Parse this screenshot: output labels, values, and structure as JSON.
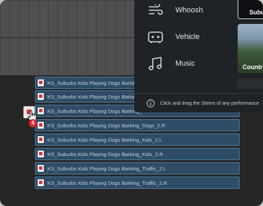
{
  "popup": {
    "items": [
      {
        "label": "Whoosh",
        "icon": "whoosh-icon"
      },
      {
        "label": "Vehicle",
        "icon": "vehicle-icon"
      },
      {
        "label": "Music",
        "icon": "music-note-icon"
      }
    ],
    "info_text": "Click and drag the Stems of any performance"
  },
  "thumbnails": {
    "suburbs_label": "Subu",
    "country_label": "Countr"
  },
  "clips": [
    "KS_Suburbs Kids Playing Dogs Barking_",
    "KS_Suburbs Kids Playing Dogs Barking_",
    "KS_Suburbs Kids Playing Dogs Barking_",
    "KS_Suburbs Kids Playing Dogs Barking_Dogs_2.R",
    "KS_Suburbs Kids Playing Dogs Barking_Kids_2.L",
    "KS_Suburbs Kids Playing Dogs Barking_Kids_2.R",
    "KS_Suburbs Kids Playing Dogs Barking_Traffic_2.L",
    "KS_Suburbs Kids Playing Dogs Barking_Traffic_2.R"
  ],
  "drag": {
    "count": "4"
  },
  "colors": {
    "clip_fill": "#2f4c66",
    "clip_border": "#4f7a9c",
    "popup_bg": "#1f2327",
    "badge": "#e0222c"
  }
}
